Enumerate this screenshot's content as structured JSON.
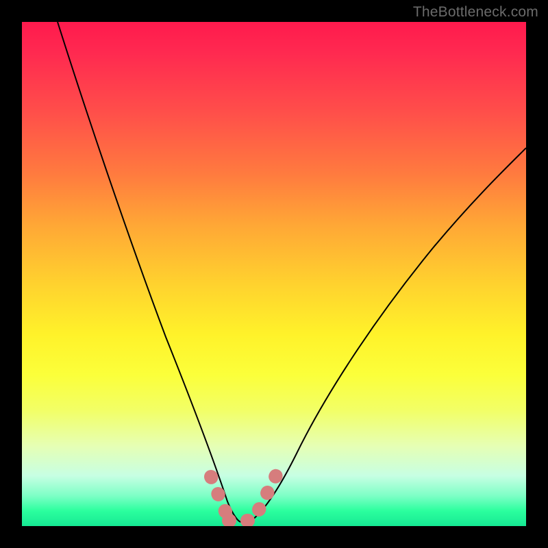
{
  "watermark": "TheBottleneck.com",
  "colors": {
    "frame": "#000000",
    "gradient_top": "#ff1a4d",
    "gradient_mid": "#fff22a",
    "gradient_bottom": "#16e893",
    "curve": "#000000",
    "markers": "#d67d7d"
  },
  "chart_data": {
    "type": "line",
    "title": "",
    "xlabel": "",
    "ylabel": "",
    "xlim": [
      0,
      100
    ],
    "ylim": [
      0,
      100
    ],
    "grid": false,
    "legend": false,
    "series": [
      {
        "name": "left_curve",
        "x": [
          7,
          10,
          14,
          18,
          22,
          26,
          30,
          34,
          37,
          39,
          41,
          43
        ],
        "y": [
          100,
          89,
          75,
          62,
          50,
          38,
          27,
          17,
          10,
          6,
          3,
          1
        ]
      },
      {
        "name": "right_curve",
        "x": [
          45,
          48,
          52,
          58,
          66,
          76,
          88,
          100
        ],
        "y": [
          1,
          3,
          8,
          17,
          31,
          48,
          63,
          75
        ]
      },
      {
        "name": "flat_bottom",
        "x": [
          40,
          47
        ],
        "y": [
          1,
          1
        ]
      }
    ],
    "markers": {
      "left": {
        "x": [
          37,
          38.5,
          40
        ],
        "y": [
          9,
          5.5,
          2
        ]
      },
      "flat": {
        "x": [
          41.5,
          44.5,
          47
        ],
        "y": [
          1,
          1,
          1
        ]
      },
      "right": {
        "x": [
          47,
          48.5,
          50
        ],
        "y": [
          3,
          6,
          9
        ]
      }
    },
    "notes": "Values estimated from pixel positions; chart has no axes, ticks, or labels visible."
  }
}
